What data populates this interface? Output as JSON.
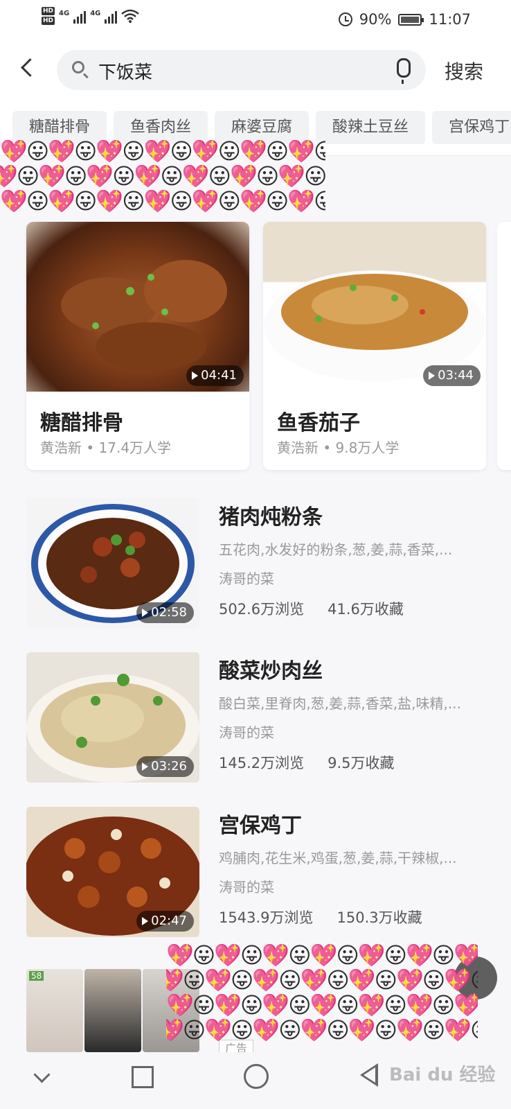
{
  "status": {
    "hd1": "HD",
    "hd2": "HD",
    "net1": "4G",
    "net2": "4G",
    "battery": "90%",
    "time": "11:07"
  },
  "search": {
    "query": "下饭菜",
    "button": "搜索"
  },
  "chips": [
    "糖醋排骨",
    "鱼香肉丝",
    "麻婆豆腐",
    "酸辣土豆丝",
    "宫保鸡丁"
  ],
  "cards": [
    {
      "title": "糖醋排骨",
      "meta": "黄浩新 • 17.4万人学",
      "duration": "04:41"
    },
    {
      "title": "鱼香茄子",
      "meta": "黄浩新 • 9.8万人学",
      "duration": "03:44"
    }
  ],
  "recipes": [
    {
      "title": "猪肉炖粉条",
      "ingredients": "五花肉,水发好的粉条,葱,姜,蒜,香菜,...",
      "author": "涛哥的菜",
      "views": "502.6万浏览",
      "favs": "41.6万收藏",
      "duration": "02:58"
    },
    {
      "title": "酸菜炒肉丝",
      "ingredients": "酸白菜,里脊肉,葱,姜,蒜,香菜,盐,味精,...",
      "author": "涛哥的菜",
      "views": "145.2万浏览",
      "favs": "9.5万收藏",
      "duration": "03:26"
    },
    {
      "title": "宫保鸡丁",
      "ingredients": "鸡脯肉,花生米,鸡蛋,葱,姜,蒜,干辣椒,...",
      "author": "涛哥的菜",
      "views": "1543.9万浏览",
      "favs": "150.3万收藏",
      "duration": "02:47"
    }
  ],
  "ad": {
    "tag": "广告",
    "badge": "58"
  },
  "watermark": "Bai du 经验",
  "emoji_row": "💖😛💖😛💖😛💖😛💖😛💖😛💖😛💖"
}
